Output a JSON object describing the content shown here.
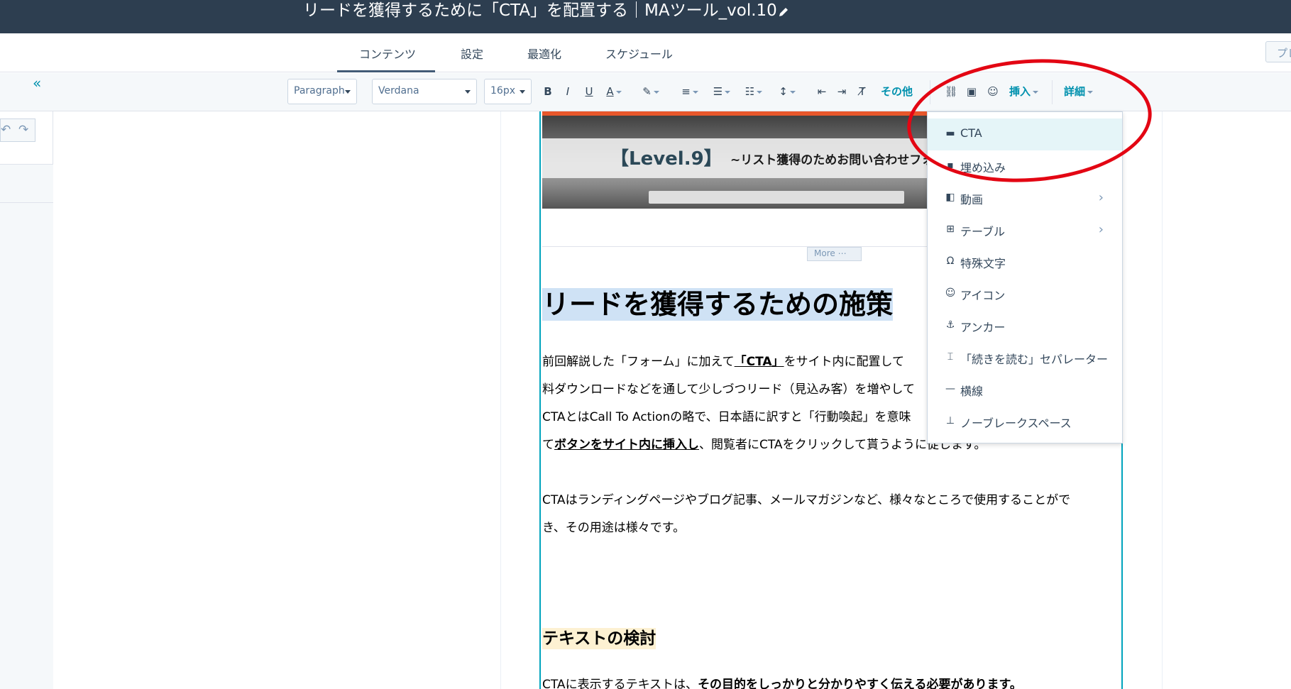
{
  "topbar": {
    "title": "リードを獲得するために「CTA」を配置する｜MAツール_vol.10"
  },
  "tabs": [
    {
      "label": "コンテンツ"
    },
    {
      "label": "設定"
    },
    {
      "label": "最適化"
    },
    {
      "label": "スケジュール"
    }
  ],
  "preview_label": "プレ",
  "toolbar": {
    "paragraph": "Paragraph",
    "font": "Verdana",
    "size": "16px",
    "bold": "B",
    "italic": "I",
    "underline": "U",
    "color": "A",
    "more_label": "その他",
    "insert_label": "挿入",
    "advanced_label": "詳細"
  },
  "hero": {
    "level": "【Level.9】",
    "subtitle": "~リスト獲得のためお問い合わせフォ"
  },
  "more_label": "More ⋯",
  "content": {
    "heading": "リードを獲得するための施策",
    "para1_a": "前回解説した「フォーム」に加えて",
    "para1_b": "「CTA」",
    "para1_c": "をサイト内に配置して",
    "para2": "料ダウンロードなどを通して少しづつリード（見込み客）を増やして",
    "para3": "CTAとはCall To Actionの略で、日本語に訳すと「行動喚起」を意味",
    "para4_a": "て",
    "para4_b": "ボタンをサイト内に挿入し",
    "para4_c": "、閲覧者にCTAをクリックして貰うように促します。",
    "para5": "CTAはランディングページやブログ記事、メールマガジンなど、様々なところで使用することがで",
    "para6": "き、その用途は様々です。",
    "heading2": "テキストの検討",
    "para7_a": "CTAに表示するテキストは、",
    "para7_b": "その目的をしっかりと分かりやすく伝える必要があります。"
  },
  "insert_menu": [
    {
      "label": "CTA",
      "icon": "cta-icon"
    },
    {
      "label": "埋め込み",
      "icon": "embed-icon"
    },
    {
      "label": "動画",
      "icon": "video-icon"
    },
    {
      "label": "テーブル",
      "icon": "table-icon"
    },
    {
      "label": "特殊文字",
      "icon": "omega-icon"
    },
    {
      "label": "アイコン",
      "icon": "icon-icon"
    },
    {
      "label": "アンカー",
      "icon": "anchor-icon"
    },
    {
      "label": "「続きを読む」セパレーター",
      "icon": "separator-icon"
    },
    {
      "label": "横線",
      "icon": "horizontal-line-icon"
    },
    {
      "label": "ノーブレークスペース",
      "icon": "nbsp-icon"
    }
  ],
  "colors": {
    "header_bg": "#2d3e50",
    "accent": "#0091ae",
    "annotation": "#e30613"
  }
}
